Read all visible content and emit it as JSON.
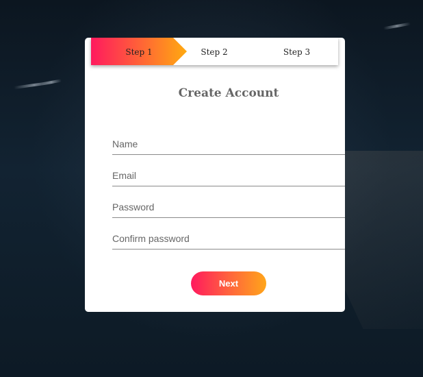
{
  "wizard": {
    "steps": [
      {
        "label": "Step 1",
        "active": true
      },
      {
        "label": "Step 2",
        "active": false
      },
      {
        "label": "Step 3",
        "active": false
      }
    ],
    "title": "Create Account"
  },
  "form": {
    "name": {
      "placeholder": "Name",
      "value": ""
    },
    "email": {
      "placeholder": "Email",
      "value": ""
    },
    "password": {
      "placeholder": "Password",
      "value": ""
    },
    "confirm_password": {
      "placeholder": "Confirm password",
      "value": ""
    },
    "next_label": "Next"
  },
  "colors": {
    "accent_start": "#ff1a5e",
    "accent_end": "#ffa51a",
    "background": "#0f1b26",
    "card": "#ffffff"
  }
}
